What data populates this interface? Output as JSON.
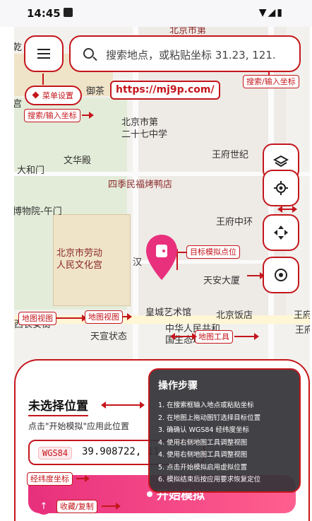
{
  "status_bar": {
    "time": "14:45"
  },
  "top": {
    "search_placeholder": "搜索地点，或粘贴坐标 31.23, 121."
  },
  "annotations": {
    "menu_settings": "菜单设置",
    "url": "https://mj9p.com/",
    "search_right": "搜索/输入坐标",
    "search_left": "搜索/输入坐标",
    "target_point": "目标模拟点位",
    "map_view": "地图视图",
    "map_view_2": "地图视图",
    "map_tools": "地图工具",
    "coord_label": "经纬度坐标",
    "fav_copy": "收藏/复制"
  },
  "map_labels": {
    "top_road": "北京市第",
    "qian": "乾",
    "yu_cha": "御茶",
    "gong": "宫",
    "school": "北京市第\n二十七中学",
    "wangfu_century": "王府世纪",
    "wenhua": "文华殿",
    "taihe": "大和门",
    "duck": "四季民福烤鸭店",
    "museum": "博物院-午门",
    "wangfu_center": "王府中环",
    "labor_palace": "北京市劳动\n人民文化宫",
    "han": "汉",
    "tiananmen_ave": "天安大厦",
    "wangfu_right": "王府",
    "huangcheng": "皇城艺术馆",
    "beijing_hotel": "北京饭店",
    "west_changan": "西长安街",
    "tiananmen_east": "天宣状态",
    "eco": "中华人民共和\n国生态环境部",
    "wang_right_2": "王府"
  },
  "sheet": {
    "title": "未选择位置",
    "hint": "点击\"开始模拟\"应用此位置",
    "badge": "WGS84",
    "coords": "39.908722, 11",
    "start_button": "开始模拟"
  },
  "steps": {
    "title": "操作步骤",
    "items": [
      "1. 在搜索框输入地点或粘贴坐标",
      "2. 在地图上拖动图钉选择目标位置",
      "3. 确确认 WGS84 经纬度坐标",
      "4. 使用右侧地图工具调整视图",
      "4. 使用右侧地图工具调整视图",
      "5. 点击开始模拟启用虚拟位置",
      "6. 模拟结束后按应用要求恢复定位"
    ]
  },
  "colors": {
    "accent": "#c4161c",
    "pink": "#e8307d"
  },
  "icons": [
    "menu-icon",
    "search-icon",
    "layers-icon",
    "locate-icon",
    "move-icon",
    "target-icon"
  ]
}
